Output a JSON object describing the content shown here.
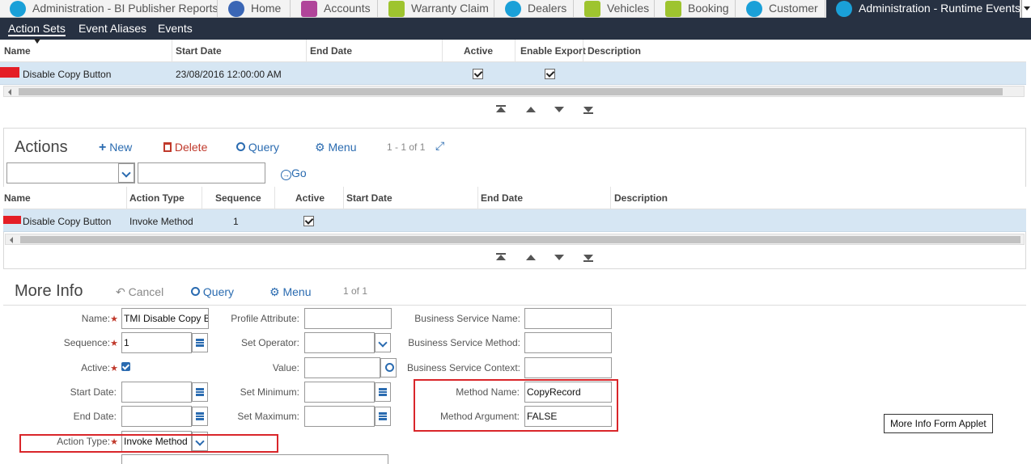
{
  "tabs": [
    {
      "label": "Administration - BI Publisher Reports",
      "icon": "bi-publisher-icon",
      "color": "#1aa0d8"
    },
    {
      "label": "Home",
      "icon": "home-icon",
      "color": "#3a66b5"
    },
    {
      "label": "Accounts",
      "icon": "accounts-icon",
      "color": "#b0459a"
    },
    {
      "label": "Warranty Claim",
      "icon": "warranty-claim-icon",
      "color": "#9ec42f"
    },
    {
      "label": "Dealers",
      "icon": "dealers-icon",
      "color": "#1aa0d8"
    },
    {
      "label": "Vehicles",
      "icon": "vehicles-icon",
      "color": "#9ec42f"
    },
    {
      "label": "Booking",
      "icon": "booking-icon",
      "color": "#9ec42f"
    },
    {
      "label": "Customer",
      "icon": "customer-icon",
      "color": "#1aa0d8"
    },
    {
      "label": "Administration - Runtime Events",
      "icon": "runtime-events-icon",
      "color": "#1aa0d8"
    }
  ],
  "subnav": [
    "Action Sets",
    "Event Aliases",
    "Events"
  ],
  "action_sets": {
    "headers": [
      "Name",
      "Start Date",
      "End Date",
      "Active",
      "Enable Export",
      "Description"
    ],
    "row": {
      "name": "Disable Copy Button",
      "start_date": "23/08/2016 12:00:00 AM",
      "end_date": "",
      "active": true,
      "enable_export": true,
      "description": ""
    }
  },
  "actions": {
    "title": "Actions",
    "new_label": "New",
    "delete_label": "Delete",
    "query_label": "Query",
    "menu_label": "Menu",
    "count": "1 - 1 of 1",
    "go_label": "Go",
    "search_value": "",
    "headers": [
      "Name",
      "Action Type",
      "Sequence",
      "Active",
      "Start Date",
      "End Date",
      "Description"
    ],
    "row": {
      "name": "Disable Copy Button",
      "action_type": "Invoke Method",
      "sequence": "1",
      "active": true
    }
  },
  "more_info": {
    "title": "More Info",
    "cancel_label": "Cancel",
    "query_label": "Query",
    "menu_label": "Menu",
    "count": "1 of 1",
    "fields": {
      "name": {
        "label": "Name:",
        "value": "TMI Disable Copy Bu"
      },
      "sequence": {
        "label": "Sequence:",
        "value": "1"
      },
      "active": {
        "label": "Active:",
        "value": true
      },
      "start_date": {
        "label": "Start Date:",
        "value": ""
      },
      "end_date": {
        "label": "End Date:",
        "value": ""
      },
      "action_type": {
        "label": "Action Type:",
        "value": "Invoke Method"
      },
      "profile_attribute": {
        "label": "Profile Attribute:",
        "value": ""
      },
      "set_operator": {
        "label": "Set Operator:",
        "value": ""
      },
      "value": {
        "label": "Value:",
        "value": ""
      },
      "set_minimum": {
        "label": "Set Minimum:",
        "value": ""
      },
      "set_maximum": {
        "label": "Set Maximum:",
        "value": ""
      },
      "bs_name": {
        "label": "Business Service Name:",
        "value": ""
      },
      "bs_method": {
        "label": "Business Service Method:",
        "value": ""
      },
      "bs_context": {
        "label": "Business Service Context:",
        "value": ""
      },
      "method_name": {
        "label": "Method Name:",
        "value": "CopyRecord"
      },
      "method_argument": {
        "label": "Method Argument:",
        "value": "FALSE"
      }
    },
    "tooltip": "More Info Form Applet"
  },
  "colors": {
    "nav_dark": "#273142",
    "row_selected": "#d6e6f3",
    "link_blue": "#2a6bb0",
    "highlight_red": "#d9262a"
  }
}
